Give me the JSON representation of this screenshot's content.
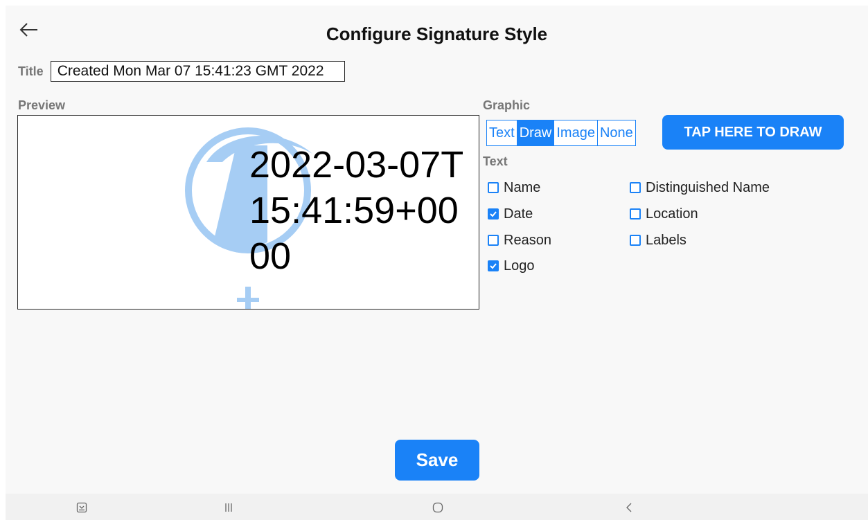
{
  "header": {
    "back_icon": "arrow-left-icon",
    "title": "Configure Signature Style"
  },
  "title_field": {
    "label": "Title",
    "value": "Created Mon Mar 07 15:41:23 GMT 2022"
  },
  "preview": {
    "label": "Preview",
    "text": "2022-03-07T15:41:59+0000",
    "logo_icon": "app-logo-icon",
    "logo_color": "#a6cdf4"
  },
  "graphic": {
    "label": "Graphic",
    "options": [
      "Text",
      "Draw",
      "Image",
      "None"
    ],
    "selected": "Draw",
    "draw_button": "TAP HERE TO DRAW"
  },
  "text_section": {
    "label": "Text",
    "options": [
      {
        "label": "Name",
        "checked": false
      },
      {
        "label": "Distinguished Name",
        "checked": false
      },
      {
        "label": "Date",
        "checked": true
      },
      {
        "label": "Location",
        "checked": false
      },
      {
        "label": "Reason",
        "checked": false
      },
      {
        "label": "Labels",
        "checked": false
      },
      {
        "label": "Logo",
        "checked": true
      }
    ]
  },
  "save_label": "Save",
  "accent_color": "#1a82f7",
  "nav_bar": {
    "recent_apps_icon": "screenshot-icon",
    "menu_icon": "recents-lines-icon",
    "home_icon": "home-circle-icon",
    "back_icon": "chevron-left-icon"
  }
}
